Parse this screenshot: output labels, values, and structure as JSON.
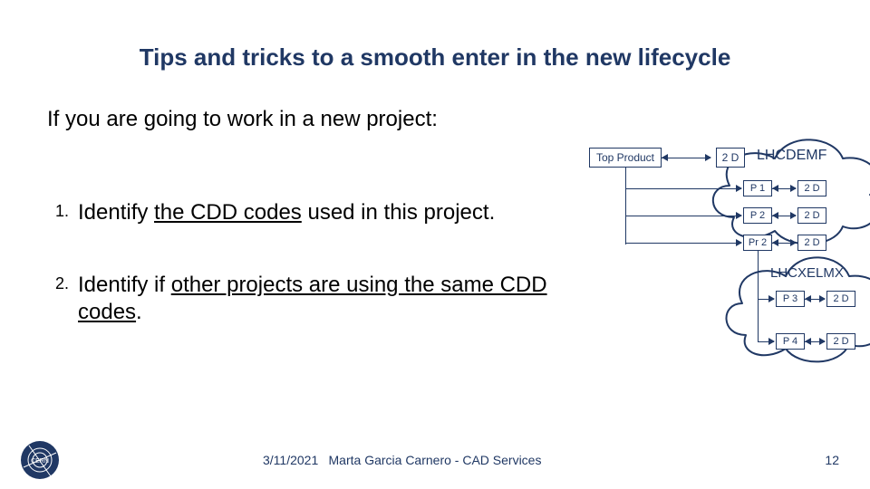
{
  "title": "Tips and tricks to a smooth enter in the new lifecycle",
  "intro": "If you are going to work in a new project:",
  "steps": [
    {
      "num": "1.",
      "pre": "Identify ",
      "u": "the CDD codes",
      "post": " used in this project."
    },
    {
      "num": "2.",
      "pre": "Identify if ",
      "u": "other projects are using the same CDD codes",
      "post": "."
    }
  ],
  "diagram": {
    "top_product": "Top Product",
    "two_d": "2 D",
    "lhcdemf": "LHCDEMF",
    "lhcxelmx": "LHCXELMX",
    "p1": "P 1",
    "p2": "P 2",
    "pr2": "Pr 2",
    "p3": "P 3",
    "p4": "P 4"
  },
  "footer": {
    "date": "3/11/2021",
    "author": "Marta Garcia Carnero - CAD Services",
    "page": "12"
  }
}
